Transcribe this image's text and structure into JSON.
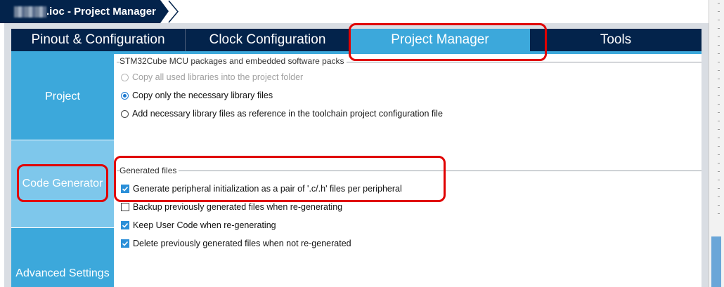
{
  "window": {
    "title": ".ioc - Project Manager"
  },
  "tabs": [
    {
      "label": "Pinout & Configuration",
      "active": false
    },
    {
      "label": "Clock Configuration",
      "active": false
    },
    {
      "label": "Project Manager",
      "active": true
    },
    {
      "label": "Tools",
      "active": false
    }
  ],
  "sidebar": {
    "items": [
      {
        "label": "Project",
        "selected": false
      },
      {
        "label": "Code Generator",
        "selected": true
      },
      {
        "label": "Advanced Settings",
        "selected": false
      }
    ]
  },
  "packages_group": {
    "title": "STM32Cube MCU packages and embedded software packs",
    "options": [
      {
        "label": "Copy all used libraries into the project folder",
        "selected": false,
        "disabled": true
      },
      {
        "label": "Copy only the necessary library files",
        "selected": true,
        "disabled": false
      },
      {
        "label": "Add necessary library files as reference in the toolchain project configuration file",
        "selected": false,
        "disabled": false
      }
    ]
  },
  "generated_files_group": {
    "title": "Generated files",
    "options": [
      {
        "label": "Generate peripheral initialization as a pair of '.c/.h' files per peripheral",
        "checked": true
      },
      {
        "label": "Backup previously generated files when re-generating",
        "checked": false
      },
      {
        "label": "Keep User Code when re-generating",
        "checked": true
      },
      {
        "label": "Delete previously generated files when not re-generated",
        "checked": true
      }
    ]
  },
  "colors": {
    "navy": "#03234b",
    "accent_blue": "#3ca8db",
    "selected_side": "#7ec7eb",
    "annotation_red": "#e00000"
  }
}
